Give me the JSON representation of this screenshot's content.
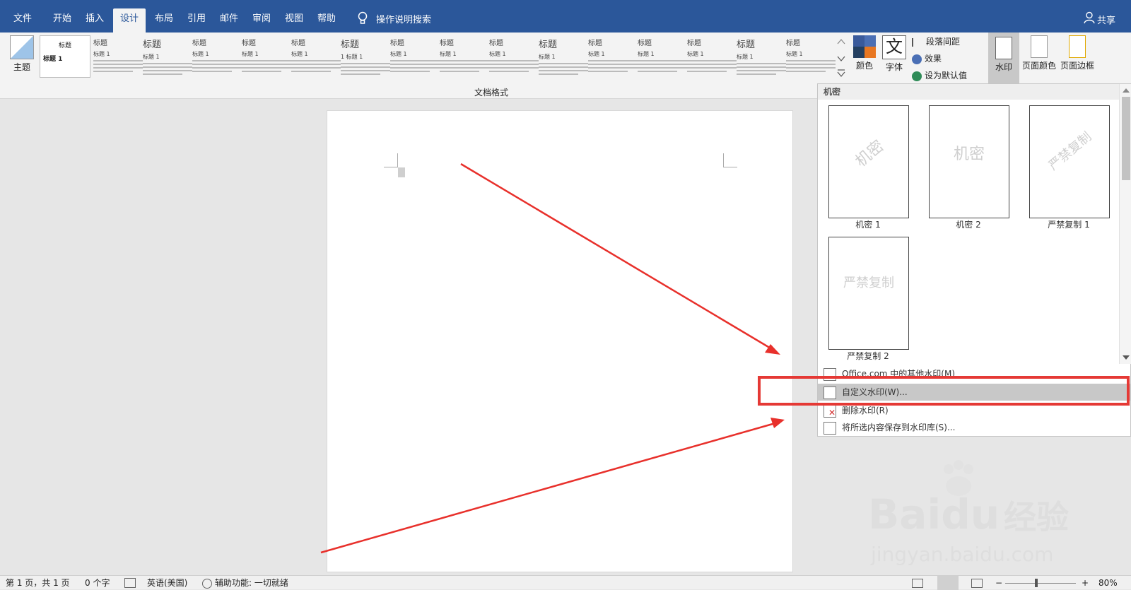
{
  "ribbon_tabs": [
    "文件",
    "开始",
    "插入",
    "设计",
    "布局",
    "引用",
    "邮件",
    "审阅",
    "视图",
    "帮助"
  ],
  "tell_me": "操作说明搜索",
  "share": "共享",
  "ribbon": {
    "theme_label": "主题",
    "style_gallery_label": "文档格式",
    "style_thumbs": [
      {
        "title": "标题",
        "sub": "标题 1"
      },
      {
        "title": "标题",
        "sub": "标题 1"
      },
      {
        "title": "标题",
        "sub": "标题 1"
      },
      {
        "title": "标题",
        "sub": "标题 1"
      },
      {
        "title": "标题",
        "sub": "标题 1"
      },
      {
        "title": "标题",
        "sub": "1 标题 1"
      },
      {
        "title": "标题",
        "sub": "标题 1"
      },
      {
        "title": "标题",
        "sub": "标题 1"
      },
      {
        "title": "标题",
        "sub": "标题 1"
      },
      {
        "title": "标题",
        "sub": "标题 1"
      },
      {
        "title": "标题",
        "sub": "标题 1"
      },
      {
        "title": "标题",
        "sub": "标题 1"
      },
      {
        "title": "标题",
        "sub": "标题 1"
      },
      {
        "title": "标题",
        "sub": "标题 1"
      },
      {
        "title": "标题",
        "sub": "标题 1"
      }
    ],
    "colors_label": "颜色",
    "fonts_label": "字体",
    "fonts_icon_char": "文",
    "paragraph_spacing": "段落间距",
    "effects": "效果",
    "set_default": "设为默认值",
    "watermark_label": "水印",
    "page_color_label": "页面颜色",
    "page_border_label": "页面边框"
  },
  "watermark_panel": {
    "section_header": "机密",
    "items": [
      {
        "text": "机密",
        "label": "机密 1"
      },
      {
        "text": "机密",
        "label": "机密 2"
      },
      {
        "text": "严禁复制",
        "label": "严禁复制 1"
      },
      {
        "text": "严禁复制",
        "label": "严禁复制 2"
      }
    ],
    "menu": {
      "more": "Office.com 中的其他水印(M)",
      "custom": "自定义水印(W)...",
      "remove": "删除水印(R)",
      "save": "将所选内容保存到水印库(S)..."
    }
  },
  "status": {
    "page": "第 1 页，共 1 页",
    "words": "0 个字",
    "language": "英语(美国)",
    "accessibility": "辅助功能: 一切就绪",
    "zoom": "80%"
  },
  "watermark_overlay": {
    "brand": "Bai",
    "du": "du",
    "jingyan": "经验",
    "url": "jingyan.baidu.com"
  },
  "colors": {
    "ribbon_blue": "#2b579a",
    "highlight_red": "#e53935",
    "arrow_red": "#e8302b"
  }
}
